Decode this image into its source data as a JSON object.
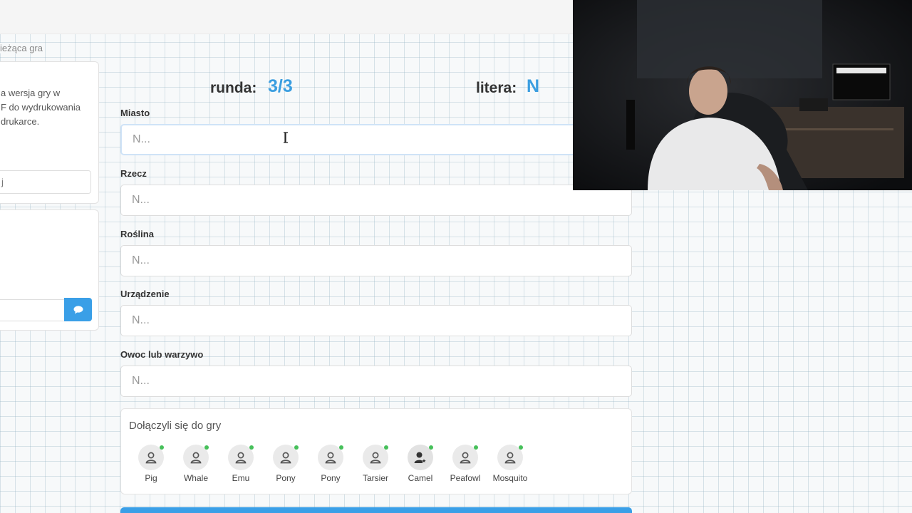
{
  "breadcrumb": "ieżąca gra",
  "sidebar": {
    "print_text_lines": [
      "a wersja gry w",
      "F do wydrukowania",
      " drukarce."
    ],
    "input_value": "j",
    "chat_send_icon": "chat-bubble-icon"
  },
  "game": {
    "round_label": "runda:",
    "round_value": "3/3",
    "letter_label": "litera:",
    "letter_value": "N"
  },
  "fields": [
    {
      "label": "Miasto",
      "placeholder": "N..."
    },
    {
      "label": "Rzecz",
      "placeholder": "N..."
    },
    {
      "label": "Roślina",
      "placeholder": "N..."
    },
    {
      "label": "Urządzenie",
      "placeholder": "N..."
    },
    {
      "label": "Owoc lub warzywo",
      "placeholder": "N..."
    }
  ],
  "players_panel": {
    "title": "Dołączyli się do gry",
    "players": [
      {
        "name": "Pig",
        "icon": "user-icon"
      },
      {
        "name": "Whale",
        "icon": "user-icon"
      },
      {
        "name": "Emu",
        "icon": "user-icon"
      },
      {
        "name": "Pony",
        "icon": "user-icon"
      },
      {
        "name": "Pony",
        "icon": "user-icon"
      },
      {
        "name": "Tarsier",
        "icon": "user-icon"
      },
      {
        "name": "Camel",
        "icon": "user-star-icon"
      },
      {
        "name": "Peafowl",
        "icon": "user-icon"
      },
      {
        "name": "Mosquito",
        "icon": "user-icon"
      }
    ]
  },
  "colors": {
    "accent": "#3b9ee0",
    "online": "#46c05a",
    "button": "#3a9fe7"
  }
}
